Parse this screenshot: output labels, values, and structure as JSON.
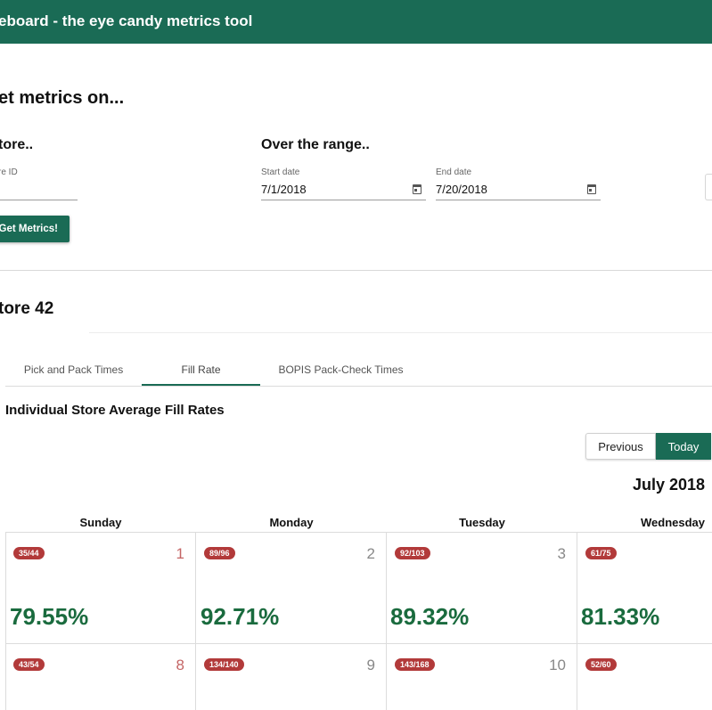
{
  "app": {
    "title": "eboard - the eye candy metrics tool"
  },
  "form": {
    "heading": "et metrics on...",
    "store_heading": "tore..",
    "range_heading": "Over the range..",
    "store_field": {
      "label": "re ID",
      "value": ""
    },
    "start_date": {
      "label": "Start date",
      "value": "7/1/2018"
    },
    "end_date": {
      "label": "End date",
      "value": "7/20/2018"
    },
    "submit_label": "Get Metrics!"
  },
  "results": {
    "store_title": "tore 42",
    "tabs": [
      {
        "label": "Pick and Pack Times",
        "active": false
      },
      {
        "label": "Fill Rate",
        "active": true
      },
      {
        "label": "BOPIS Pack-Check Times",
        "active": false
      }
    ],
    "section_title": "Individual Store Average Fill Rates",
    "nav": {
      "previous_label": "Previous",
      "today_label": "Today"
    },
    "month_title": "July 2018",
    "weekdays": [
      "Sunday",
      "Monday",
      "Tuesday",
      "Wednesday"
    ],
    "weeks": [
      [
        {
          "badge": "35/44",
          "day": "1",
          "percent": "79.55%"
        },
        {
          "badge": "89/96",
          "day": "2",
          "percent": "92.71%"
        },
        {
          "badge": "92/103",
          "day": "3",
          "percent": "89.32%"
        },
        {
          "badge": "61/75",
          "day": "",
          "percent": "81.33%"
        }
      ],
      [
        {
          "badge": "43/54",
          "day": "8",
          "percent": ""
        },
        {
          "badge": "134/140",
          "day": "9",
          "percent": ""
        },
        {
          "badge": "143/168",
          "day": "10",
          "percent": ""
        },
        {
          "badge": "52/60",
          "day": "",
          "percent": ""
        }
      ]
    ]
  },
  "colors": {
    "brand_green": "#1a6b55",
    "percent_green": "#1a6b3e",
    "badge_red": "#b23a3a",
    "sunday_number": "#c46565"
  }
}
